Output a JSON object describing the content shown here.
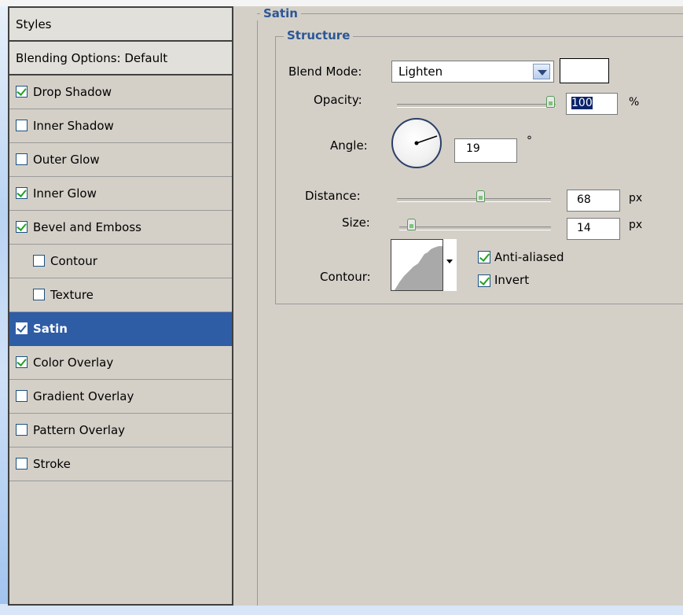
{
  "styles_panel": {
    "header": "Styles",
    "blending_options": "Blending Options: Default",
    "items": [
      {
        "label": "Drop Shadow",
        "checked": true
      },
      {
        "label": "Inner Shadow",
        "checked": false
      },
      {
        "label": "Outer Glow",
        "checked": false
      },
      {
        "label": "Inner Glow",
        "checked": true
      },
      {
        "label": "Bevel and Emboss",
        "checked": true
      },
      {
        "label": "Contour",
        "checked": false
      },
      {
        "label": "Texture",
        "checked": false
      },
      {
        "label": "Satin",
        "checked": true,
        "selected": true
      },
      {
        "label": "Color Overlay",
        "checked": true
      },
      {
        "label": "Gradient Overlay",
        "checked": false
      },
      {
        "label": "Pattern Overlay",
        "checked": false
      },
      {
        "label": "Stroke",
        "checked": false
      }
    ]
  },
  "satin": {
    "title": "Satin",
    "structure_title": "Structure",
    "blend_mode_label": "Blend Mode:",
    "blend_mode_value": "Lighten",
    "swatch_color": "#ffffff",
    "opacity_label": "Opacity:",
    "opacity_value": "100",
    "opacity_unit": "%",
    "angle_label": "Angle:",
    "angle_value": "19",
    "angle_unit": "°",
    "distance_label": "Distance:",
    "distance_value": "68",
    "distance_unit": "px",
    "size_label": "Size:",
    "size_value": "14",
    "size_unit": "px",
    "contour_label": "Contour:",
    "anti_aliased_label": "Anti-aliased",
    "anti_aliased_checked": true,
    "invert_label": "Invert",
    "invert_checked": true
  },
  "colors": {
    "selection": "#2e5da6",
    "accent_title": "#2b5797",
    "check": "#21a121"
  }
}
